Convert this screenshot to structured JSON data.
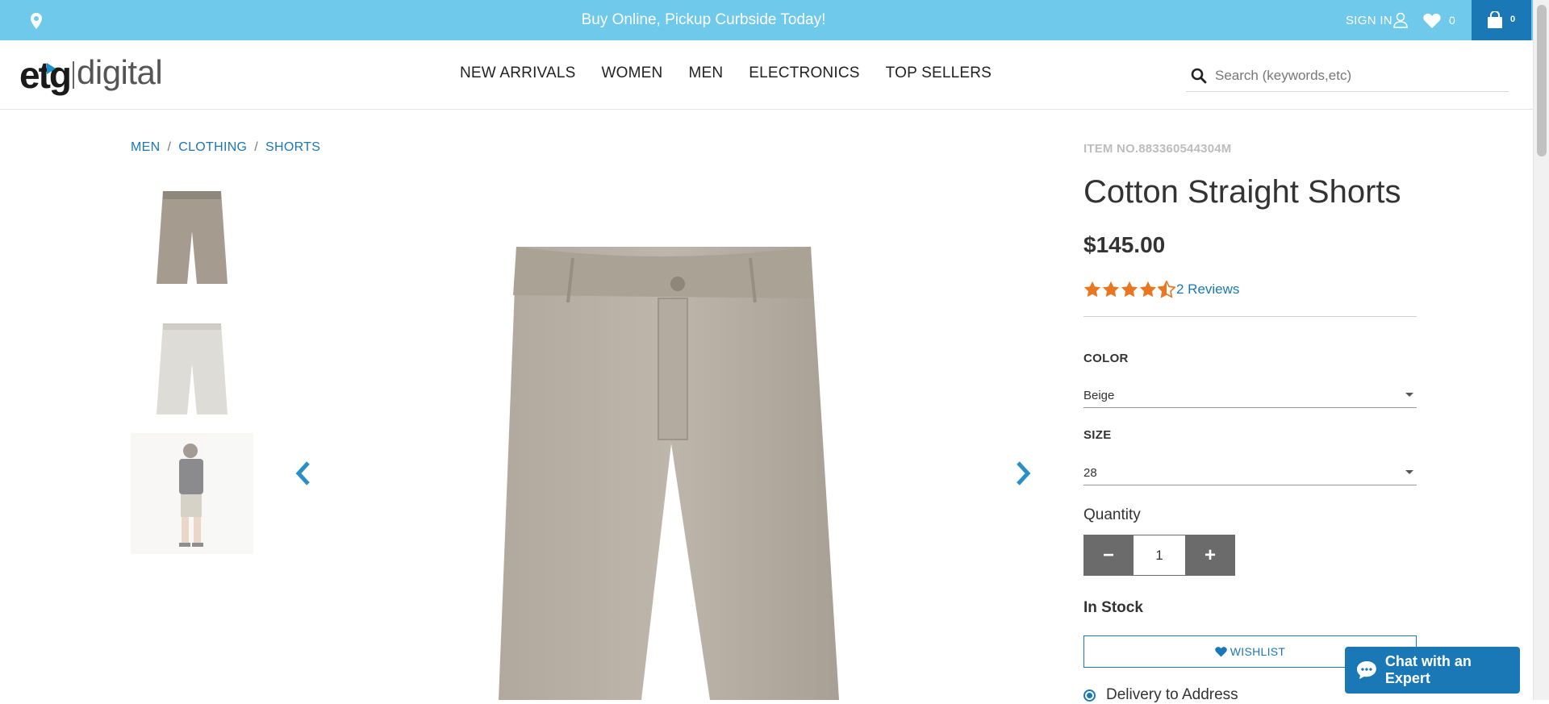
{
  "colors": {
    "topbar": "#6ec9ea",
    "accent": "#1b78b6",
    "star": "#e87722",
    "qty_button": "#6b6b6b"
  },
  "topbar": {
    "location_icon": "map-pin-icon",
    "promo": "Buy Online, Pickup Curbside Today!",
    "sign_in": "SIGN IN",
    "user_icon": "user-icon",
    "wishlist_icon": "heart-icon",
    "wishlist_count": "0",
    "cart_icon": "shopping-bag-icon",
    "cart_count": "0"
  },
  "header": {
    "logo_part1": "etg",
    "logo_part2": "digital",
    "nav": [
      "NEW ARRIVALS",
      "WOMEN",
      "MEN",
      "ELECTRONICS",
      "TOP SELLERS"
    ],
    "search_placeholder": "Search (keywords,etc)",
    "search_icon": "search-icon"
  },
  "breadcrumb": [
    "MEN",
    "CLOTHING",
    "SHORTS"
  ],
  "gallery": {
    "thumbnails": [
      "shorts-front",
      "shorts-back",
      "model-wearing-shorts"
    ],
    "prev_icon": "chevron-left-icon",
    "next_icon": "chevron-right-icon"
  },
  "product": {
    "item_no": "ITEM NO.883360544304M",
    "title": "Cotton Straight Shorts",
    "price": "$145.00",
    "rating": 4.5,
    "rating_max": 5,
    "reviews": "2 Reviews",
    "color_label": "COLOR",
    "color_value": "Beige",
    "size_label": "SIZE",
    "size_value": "28",
    "quantity_label": "Quantity",
    "quantity_minus": "−",
    "quantity_value": "1",
    "quantity_plus": "+",
    "stock": "In Stock",
    "wishlist_button": "WISHLIST",
    "delivery_option": "Delivery to Address"
  },
  "chat": {
    "label": "Chat with an Expert",
    "icon": "chat-bubble-icon"
  }
}
